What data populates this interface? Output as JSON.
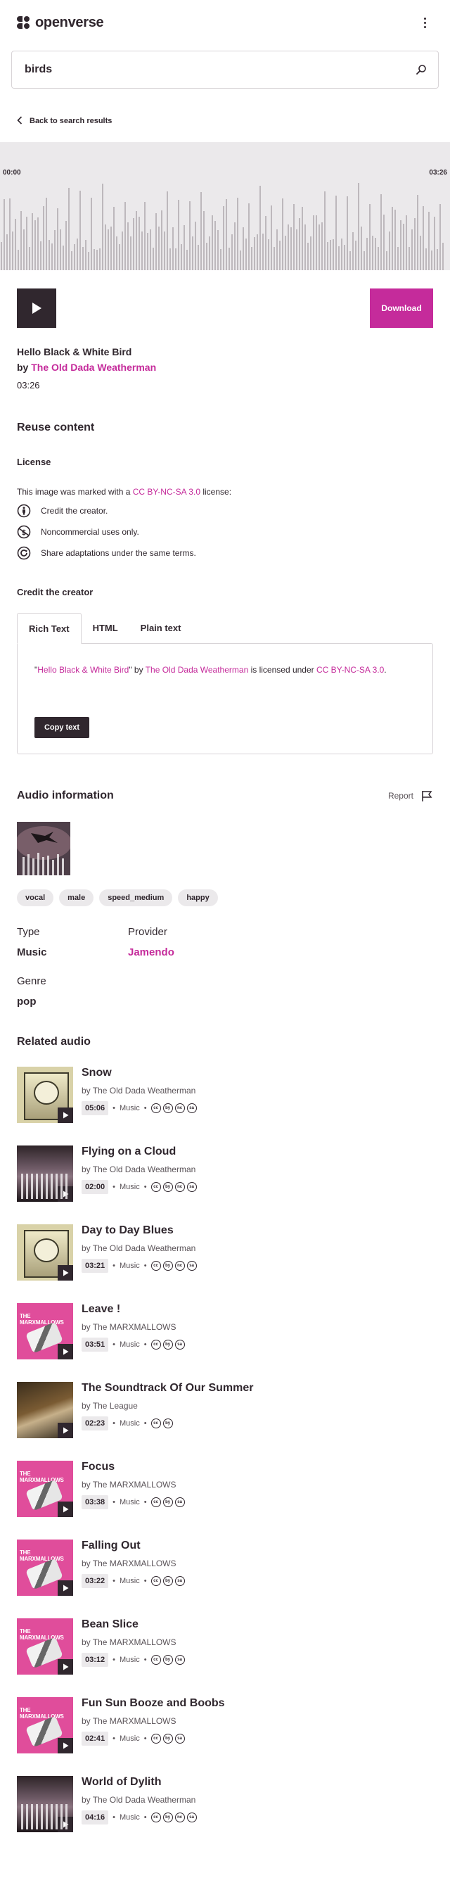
{
  "header": {
    "logo_text": "openverse"
  },
  "search": {
    "value": "birds"
  },
  "nav": {
    "back_label": "Back to search results"
  },
  "player": {
    "time_start": "00:00",
    "time_end": "03:26",
    "download_label": "Download"
  },
  "track": {
    "title": "Hello Black & White Bird",
    "by": "by",
    "artist": "The Old Dada Weatherman",
    "duration": "03:26"
  },
  "reuse": {
    "heading": "Reuse content",
    "license_heading": "License",
    "license_prefix": "This image was marked with a",
    "license_name": "CC BY-NC-SA 3.0",
    "license_suffix": "license:",
    "items": [
      {
        "icon": "by-icon",
        "text": "Credit the creator."
      },
      {
        "icon": "nc-icon",
        "text": "Noncommercial uses only."
      },
      {
        "icon": "sa-icon",
        "text": "Share adaptations under the same terms."
      }
    ],
    "credit_heading": "Credit the creator",
    "tabs": [
      "Rich Text",
      "HTML",
      "Plain text"
    ],
    "attribution": {
      "title": "Hello Black & White Bird",
      "by_text": "by",
      "artist": "The Old Dada Weatherman",
      "licensed_text": "is licensed under",
      "license": "CC BY-NC-SA 3.0"
    },
    "copy_label": "Copy text"
  },
  "audio_info": {
    "heading": "Audio information",
    "report_label": "Report",
    "tags": [
      "vocal",
      "male",
      "speed_medium",
      "happy"
    ],
    "type_label": "Type",
    "type_value": "Music",
    "provider_label": "Provider",
    "provider_value": "Jamendo",
    "genre_label": "Genre",
    "genre_value": "pop"
  },
  "related": {
    "heading": "Related audio",
    "items": [
      {
        "title": "Snow",
        "artist": "by The Old Dada Weatherman",
        "duration": "05:06",
        "category": "Music",
        "licenses": [
          "cc",
          "by",
          "nc",
          "sa"
        ],
        "thumb": "sepia"
      },
      {
        "title": "Flying on a Cloud",
        "artist": "by The Old Dada Weatherman",
        "duration": "02:00",
        "category": "Music",
        "licenses": [
          "cc",
          "by",
          "nc",
          "sa"
        ],
        "thumb": "dark"
      },
      {
        "title": "Day to Day Blues",
        "artist": "by The Old Dada Weatherman",
        "duration": "03:21",
        "category": "Music",
        "licenses": [
          "cc",
          "by",
          "nc",
          "sa"
        ],
        "thumb": "sepia"
      },
      {
        "title": "Leave !",
        "artist": "by The MARXMALLOWS",
        "duration": "03:51",
        "category": "Music",
        "licenses": [
          "cc",
          "by",
          "sa"
        ],
        "thumb": "pink"
      },
      {
        "title": "The Soundtrack Of Our Summer",
        "artist": "by The League",
        "duration": "02:23",
        "category": "Music",
        "licenses": [
          "cc",
          "by"
        ],
        "thumb": "league"
      },
      {
        "title": "Focus",
        "artist": "by The MARXMALLOWS",
        "duration": "03:38",
        "category": "Music",
        "licenses": [
          "cc",
          "by",
          "sa"
        ],
        "thumb": "pink"
      },
      {
        "title": "Falling Out",
        "artist": "by The MARXMALLOWS",
        "duration": "03:22",
        "category": "Music",
        "licenses": [
          "cc",
          "by",
          "sa"
        ],
        "thumb": "pink"
      },
      {
        "title": "Bean Slice",
        "artist": "by The MARXMALLOWS",
        "duration": "03:12",
        "category": "Music",
        "licenses": [
          "cc",
          "by",
          "sa"
        ],
        "thumb": "pink"
      },
      {
        "title": "Fun Sun Booze and Boobs",
        "artist": "by The MARXMALLOWS",
        "duration": "02:41",
        "category": "Music",
        "licenses": [
          "cc",
          "by",
          "sa"
        ],
        "thumb": "pink"
      },
      {
        "title": "World of Dylith",
        "artist": "by The Old Dada Weatherman",
        "duration": "04:16",
        "category": "Music",
        "licenses": [
          "cc",
          "by",
          "nc",
          "sa"
        ],
        "thumb": "dark"
      }
    ]
  },
  "colors": {
    "accent": "#c52b9b",
    "dark": "#30272e",
    "waveform_bg": "#ebe9eb",
    "bar": "#bdb8bc"
  }
}
